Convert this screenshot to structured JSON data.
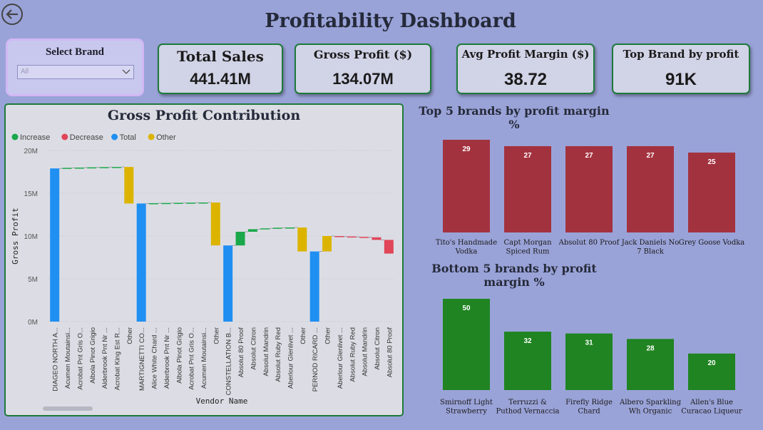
{
  "page": {
    "title": "Profitability Dashboard"
  },
  "slicer": {
    "label": "Select Brand",
    "value": "All"
  },
  "kpis": [
    {
      "title": "Total Sales",
      "value": "441.41M"
    },
    {
      "title": "Gross Profit ($)",
      "value": "134.07M"
    },
    {
      "title": "Avg Profit Margin ($)",
      "value": "38.72"
    },
    {
      "title": "Top Brand by profit",
      "value": "91K"
    }
  ],
  "colors": {
    "increase": "#1aa84a",
    "decrease": "#e04558",
    "total": "#1f8ff2",
    "other": "#dcb400",
    "top_bar": "#a3323f",
    "bottom_bar": "#1f8421"
  },
  "chart_data": [
    {
      "type": "waterfall",
      "title": "Gross Profit Contribution",
      "xlabel": "Vendor Name",
      "ylabel": "Gross Profit",
      "ylim": [
        0,
        20
      ],
      "y_unit": "M",
      "yticks": [
        "0M",
        "5M",
        "10M",
        "15M",
        "20M"
      ],
      "legend": [
        {
          "name": "Increase",
          "color": "#1aa84a"
        },
        {
          "name": "Decrease",
          "color": "#e04558"
        },
        {
          "name": "Total",
          "color": "#1f8ff2"
        },
        {
          "name": "Other",
          "color": "#dcb400"
        }
      ],
      "bars": [
        {
          "label": "DIAGEO NORTH A...",
          "kind": "total",
          "start": 0,
          "end": 17.9
        },
        {
          "label": "Acumen Moutainsi...",
          "kind": "increase",
          "start": 17.9,
          "end": 17.97
        },
        {
          "label": "Acrobat Pnt Gris O...",
          "kind": "increase",
          "start": 17.97,
          "end": 18.0
        },
        {
          "label": "Albola Pinot Grigio",
          "kind": "increase",
          "start": 18.0,
          "end": 18.03
        },
        {
          "label": "Alderbrook Pnt Nr ...",
          "kind": "increase",
          "start": 18.03,
          "end": 18.05
        },
        {
          "label": "Acrobat King Est R...",
          "kind": "increase",
          "start": 18.05,
          "end": 18.07
        },
        {
          "label": "Other",
          "kind": "other",
          "start": 18.07,
          "end": 13.8
        },
        {
          "label": "MARTIGNETTI CO...",
          "kind": "total",
          "start": 0,
          "end": 13.8
        },
        {
          "label": "Alice White Chard ...",
          "kind": "increase",
          "start": 13.8,
          "end": 13.84
        },
        {
          "label": "Alderbrook Pnt Nr ...",
          "kind": "increase",
          "start": 13.84,
          "end": 13.86
        },
        {
          "label": "Albola Pinot Grigio",
          "kind": "increase",
          "start": 13.86,
          "end": 13.88
        },
        {
          "label": "Acrobat Pnt Gris O...",
          "kind": "increase",
          "start": 13.88,
          "end": 13.9
        },
        {
          "label": "Acumen Moutainsi...",
          "kind": "increase",
          "start": 13.9,
          "end": 13.92
        },
        {
          "label": "Other",
          "kind": "other",
          "start": 13.92,
          "end": 8.9
        },
        {
          "label": "CONSTELLATION B...",
          "kind": "total",
          "start": 0,
          "end": 8.9
        },
        {
          "label": "Absolut 80 Proof",
          "kind": "increase",
          "start": 8.9,
          "end": 10.5
        },
        {
          "label": "Absolut Citron",
          "kind": "increase",
          "start": 10.5,
          "end": 10.8
        },
        {
          "label": "Absolut Mandrin",
          "kind": "increase",
          "start": 10.8,
          "end": 10.9
        },
        {
          "label": "Absolut Ruby Red",
          "kind": "increase",
          "start": 10.9,
          "end": 10.97
        },
        {
          "label": "Aberlour Glenlivet ...",
          "kind": "increase",
          "start": 10.97,
          "end": 11.0
        },
        {
          "label": "Other",
          "kind": "other",
          "start": 11.0,
          "end": 8.2
        },
        {
          "label": "PERNOD RICARD ...",
          "kind": "total",
          "start": 0,
          "end": 8.2
        },
        {
          "label": "Other",
          "kind": "other",
          "start": 8.2,
          "end": 10.0
        },
        {
          "label": "Aberlour Glenlivet ...",
          "kind": "decrease",
          "start": 10.0,
          "end": 9.95
        },
        {
          "label": "Absolut Ruby Red",
          "kind": "decrease",
          "start": 9.95,
          "end": 9.9
        },
        {
          "label": "Absolut Mandrin",
          "kind": "decrease",
          "start": 9.9,
          "end": 9.85
        },
        {
          "label": "Absolut Citron",
          "kind": "decrease",
          "start": 9.85,
          "end": 9.55
        },
        {
          "label": "Absolut 80 Proof",
          "kind": "decrease",
          "start": 9.55,
          "end": 7.95
        }
      ]
    },
    {
      "type": "bar",
      "title": "Top 5 brands by profit margin %",
      "categories": [
        "Tito's Handmade Vodka",
        "Capt Morgan Spiced Rum",
        "Absolut 80 Proof",
        "Jack Daniels No 7 Black",
        "Grey Goose Vodka"
      ],
      "values": [
        29,
        27,
        27,
        27,
        25
      ],
      "data_labels": [
        "29",
        "27",
        "27",
        "27",
        "25"
      ],
      "color": "#a3323f"
    },
    {
      "type": "bar",
      "title": "Bottom 5 brands by profit margin %",
      "categories": [
        "Smirnoff Light Strawberry",
        "Terruzzi & Puthod Vernaccia",
        "Firefly Ridge Chard",
        "Albero Sparkling Wh Organic",
        "Allen's Blue Curacao Liqueur"
      ],
      "values": [
        50,
        32,
        31,
        28,
        20
      ],
      "data_labels": [
        "50",
        "32",
        "31",
        "28",
        "20"
      ],
      "color": "#1f8421"
    }
  ]
}
